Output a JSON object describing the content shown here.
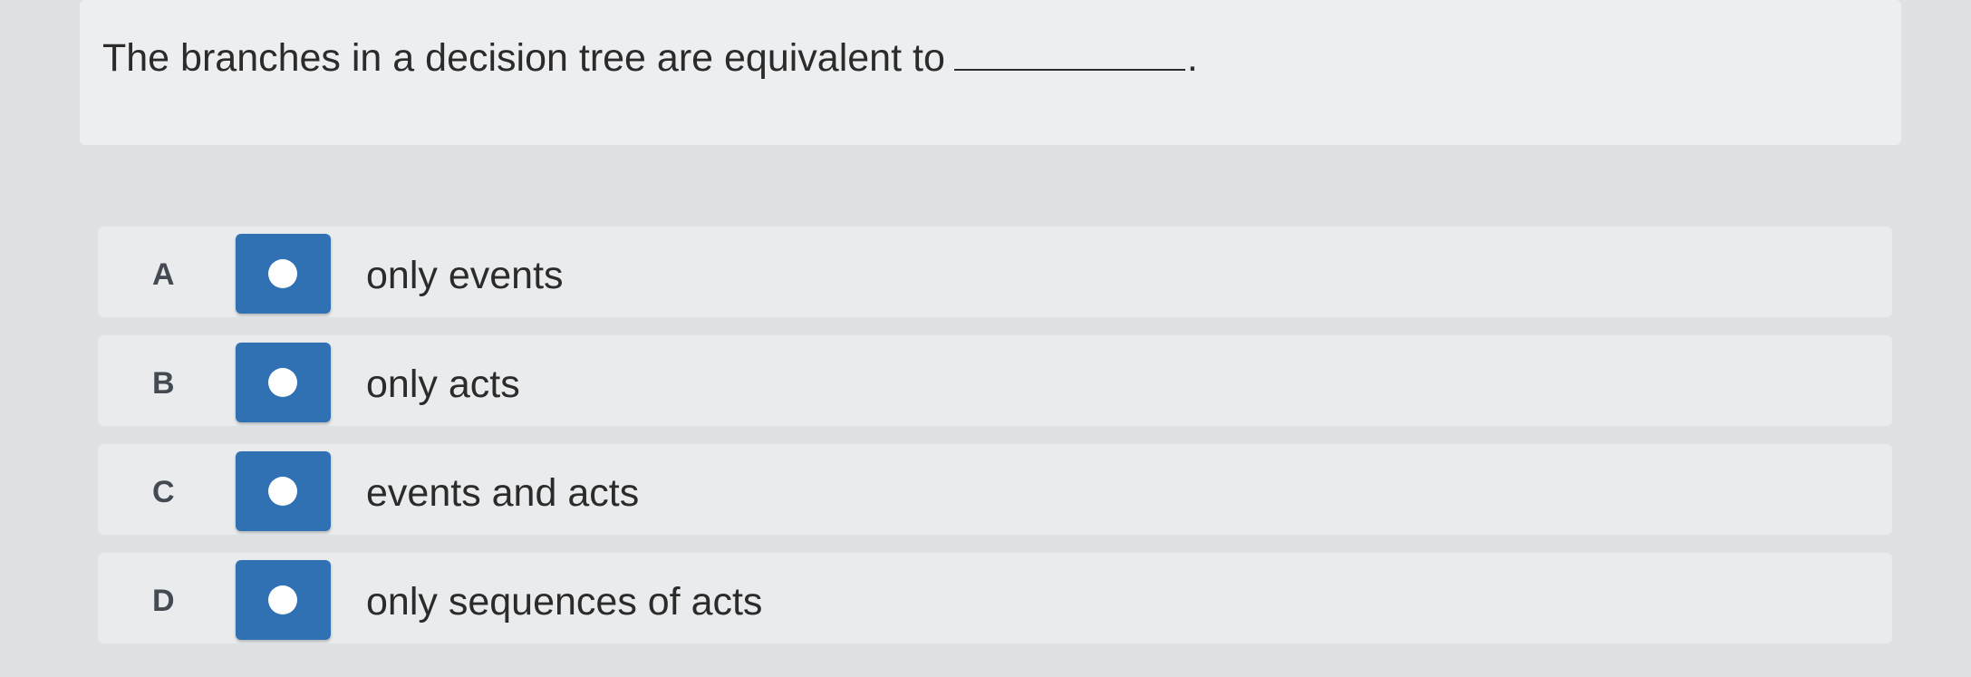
{
  "question": {
    "text": "The branches in a decision tree are equivalent to",
    "blank_suffix": "."
  },
  "options": [
    {
      "letter": "A",
      "label": "only events"
    },
    {
      "letter": "B",
      "label": "only acts"
    },
    {
      "letter": "C",
      "label": "events and acts"
    },
    {
      "letter": "D",
      "label": "only sequences of acts"
    }
  ],
  "colors": {
    "radio_button": "#2f71b3",
    "background": "#dfe2e5"
  }
}
